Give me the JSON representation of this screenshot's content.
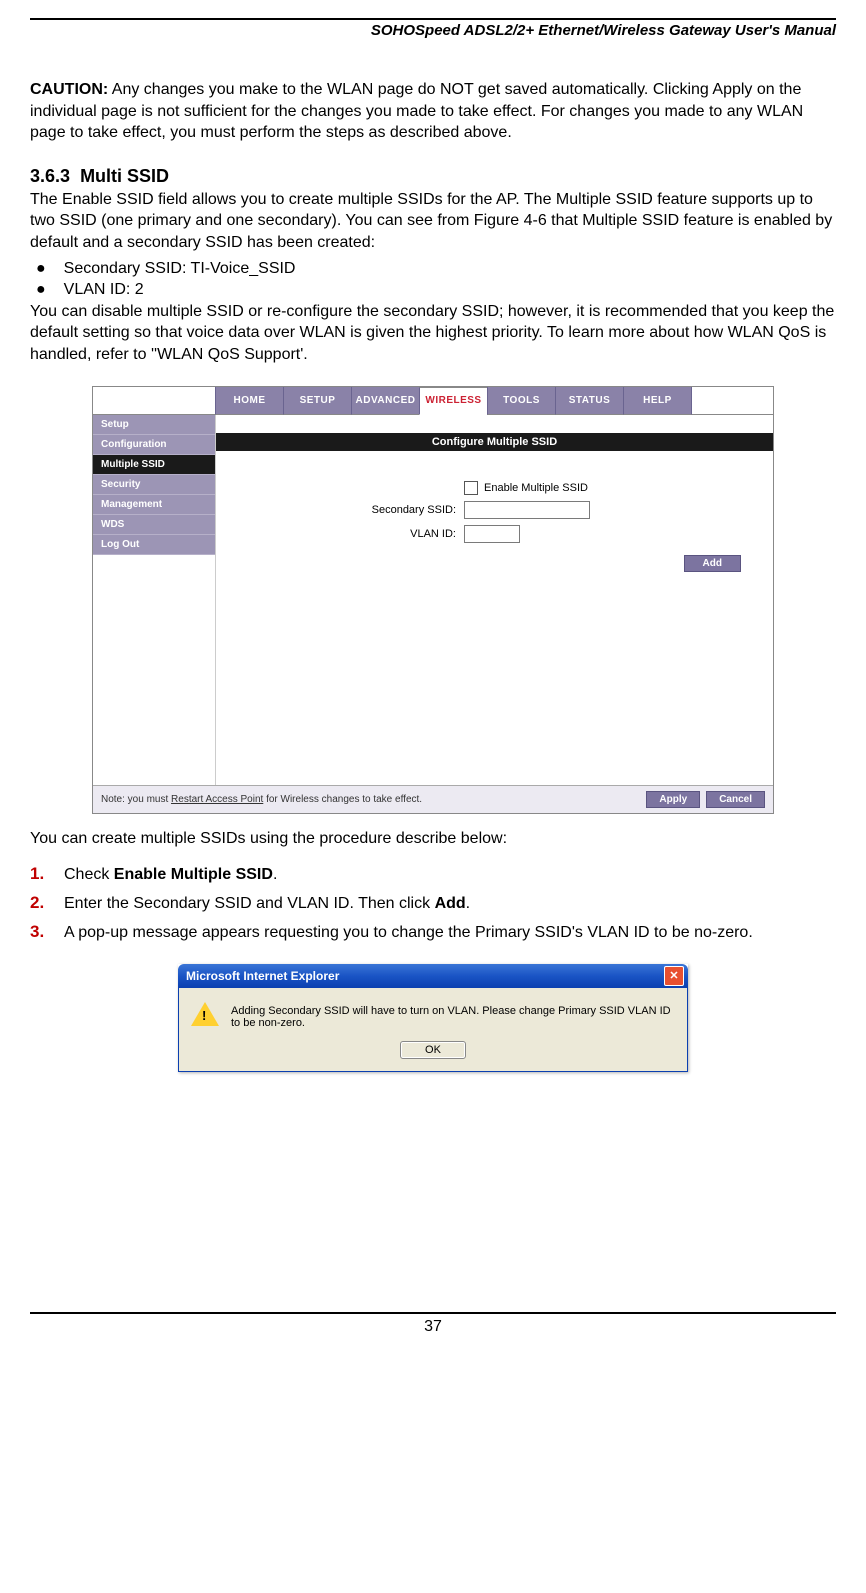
{
  "doc": {
    "header_title": "SOHOSpeed ADSL2/2+ Ethernet/Wireless Gateway User's Manual",
    "caution_label": "CAUTION:",
    "caution_text": " Any changes you make to the WLAN page do NOT get saved automatically. Clicking Apply on the individual page is not sufficient for the changes you made to take effect. For changes you made to any WLAN page to take effect, you must perform the steps as described above.",
    "section_num": "3.6.3",
    "section_title": "Multi SSID",
    "intro_para": "The Enable SSID field allows you to create multiple SSIDs for the AP. The Multiple SSID feature supports up to two SSID (one primary and one secondary). You can see from Figure 4-6 that Multiple SSID feature is enabled by default and a secondary SSID has been created:",
    "bullets": [
      "Secondary SSID: TI-Voice_SSID",
      "VLAN ID: 2"
    ],
    "after_bullets": "You can disable multiple SSID or re-configure the secondary SSID; however, it is recommended that you keep the default setting so that voice data over WLAN is given the highest priority. To learn more about how WLAN QoS is handled, refer to ''WLAN QoS Support'.",
    "procedure_intro": "You can create multiple SSIDs using the procedure describe below:",
    "steps": [
      {
        "num": "1.",
        "pre": "Check ",
        "bold": "Enable Multiple SSID",
        "post": "."
      },
      {
        "num": "2.",
        "pre": "Enter the Secondary SSID and VLAN ID. Then click ",
        "bold": "Add",
        "post": "."
      },
      {
        "num": "3.",
        "pre": "A pop-up message appears requesting you to change the Primary SSID's VLAN ID to be no-zero.",
        "bold": "",
        "post": ""
      }
    ],
    "page_number": "37"
  },
  "router": {
    "tabs": [
      "HOME",
      "SETUP",
      "ADVANCED",
      "WIRELESS",
      "TOOLS",
      "STATUS",
      "HELP"
    ],
    "active_tab_index": 3,
    "sidebar": [
      "Setup",
      "Configuration",
      "Multiple SSID",
      "Security",
      "Management",
      "WDS",
      "Log Out"
    ],
    "active_sidebar_index": 2,
    "panel_title": "Configure Multiple SSID",
    "enable_label": "Enable Multiple SSID",
    "secondary_label": "Secondary SSID:",
    "vlan_label": "VLAN ID:",
    "secondary_value": "",
    "vlan_value": "",
    "add_btn": "Add",
    "footer_note_pre": "Note: you must ",
    "footer_note_link": "Restart Access Point",
    "footer_note_post": " for Wireless changes to take effect.",
    "apply_btn": "Apply",
    "cancel_btn": "Cancel"
  },
  "dialog": {
    "title": "Microsoft Internet Explorer",
    "message": "Adding Secondary SSID will have to turn on VLAN. Please change Primary SSID VLAN ID to be non-zero.",
    "ok": "OK",
    "close": "✕"
  }
}
